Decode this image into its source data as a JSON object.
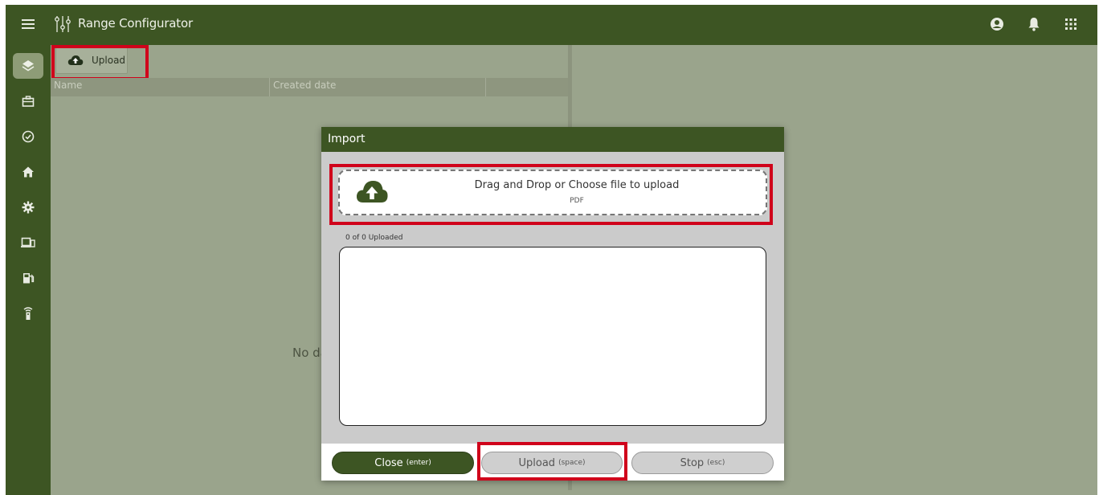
{
  "app": {
    "title": "Range Configurator"
  },
  "toolbar": {
    "upload_label": "Upload"
  },
  "grid": {
    "columns": [
      "Name",
      "Created date",
      ""
    ],
    "empty_text": "No da"
  },
  "top_icons": [
    "account-circle-icon",
    "bell-icon",
    "apps-grid-icon"
  ],
  "sidebar": {
    "items": [
      {
        "icon": "layers-icon",
        "active": true
      },
      {
        "icon": "briefcase-icon",
        "active": false
      },
      {
        "icon": "check-circle-icon",
        "active": false
      },
      {
        "icon": "home-icon",
        "active": false
      },
      {
        "icon": "gear-icon",
        "active": false
      },
      {
        "icon": "devices-icon",
        "active": false
      },
      {
        "icon": "fuel-icon",
        "active": false
      },
      {
        "icon": "remote-icon",
        "active": false
      }
    ]
  },
  "modal": {
    "title": "Import",
    "dropzone_text": "Drag and Drop or Choose file to upload",
    "dropzone_sub": "PDF",
    "upload_count": "0 of 0 Uploaded",
    "buttons": {
      "close_label": "Close",
      "close_hint": "(enter)",
      "upload_label": "Upload",
      "upload_hint": "(space)",
      "stop_label": "Stop",
      "stop_hint": "(esc)"
    }
  },
  "colors": {
    "brand_green": "#3d5523",
    "highlight_red": "#d0021b"
  }
}
